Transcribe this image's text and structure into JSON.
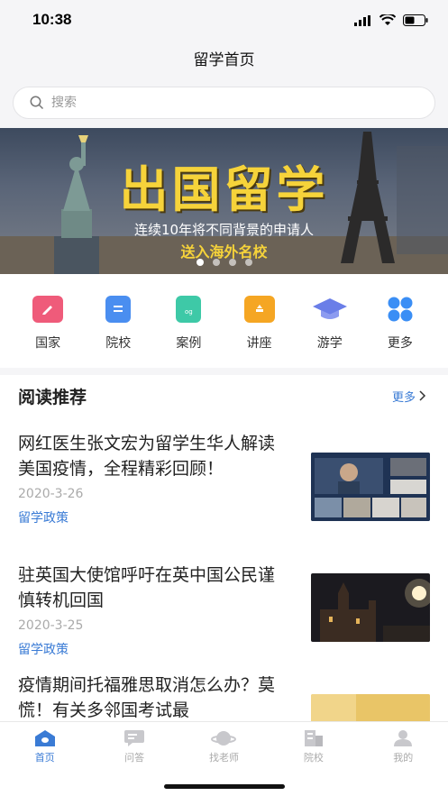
{
  "status": {
    "time": "10:38"
  },
  "nav": {
    "title": "留学首页"
  },
  "search": {
    "placeholder": "搜索"
  },
  "banner": {
    "title": "出国留学",
    "subtitle": "连续10年将不同背景的申请人",
    "subtitle2": "送入海外名校",
    "active_dot": 1,
    "dot_count": 4
  },
  "categories": [
    {
      "label": "国家",
      "icon": "flag-icon",
      "color": "#ef5b7a"
    },
    {
      "label": "院校",
      "icon": "school-icon",
      "color": "#4a8ef0"
    },
    {
      "label": "案例",
      "icon": "case-icon",
      "color": "#3ec9a7"
    },
    {
      "label": "讲座",
      "icon": "lecture-icon",
      "color": "#f5a623"
    },
    {
      "label": "游学",
      "icon": "study-tour-icon",
      "color": "#6a7ee8"
    },
    {
      "label": "更多",
      "icon": "more-grid-icon",
      "color": "#3a8ef5"
    }
  ],
  "reading": {
    "title": "阅读推荐",
    "more": "更多",
    "articles": [
      {
        "title": "网红医生张文宏为留学生华人解读美国疫情，全程精彩回顾！",
        "date": "2020-3-26",
        "tag": "留学政策"
      },
      {
        "title": "驻英国大使馆呼吁在英中国公民谨慎转机回国",
        "date": "2020-3-25",
        "tag": "留学政策"
      },
      {
        "title": "疫情期间托福雅思取消怎么办？莫慌！有关多邻国考试最",
        "date": "",
        "tag": ""
      }
    ]
  },
  "tabbar": {
    "tabs": [
      {
        "label": "首页",
        "icon": "home-icon",
        "active": true
      },
      {
        "label": "问答",
        "icon": "chat-icon",
        "active": false
      },
      {
        "label": "找老师",
        "icon": "planet-icon",
        "active": false
      },
      {
        "label": "院校",
        "icon": "building-icon",
        "active": false
      },
      {
        "label": "我的",
        "icon": "profile-icon",
        "active": false
      }
    ]
  }
}
